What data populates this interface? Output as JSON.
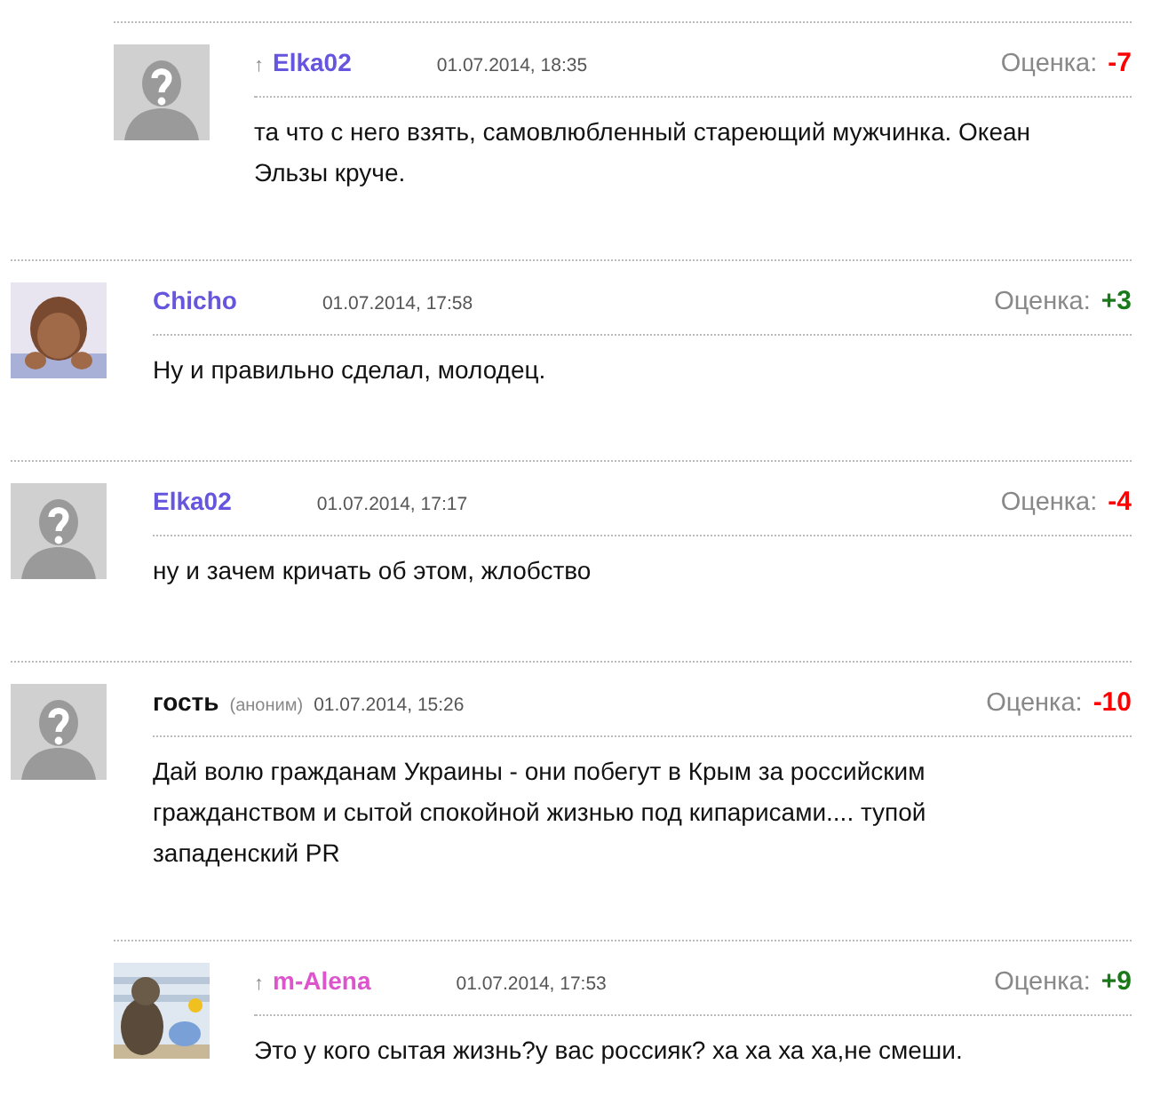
{
  "comments": [
    {
      "reply": true,
      "avatar": {
        "kind": "default"
      },
      "reply_mark": "↑",
      "author": {
        "name": "Elka02",
        "color": "#6655dd"
      },
      "date": "01.07.2014, 18:35",
      "score_label": "Оценка:",
      "score": {
        "value": "-7",
        "color": "#ff0000"
      },
      "text": "та что с него взять, самовлюбленный стареющий мужчинка. Океан Эльзы круче."
    },
    {
      "reply": false,
      "author": {
        "name": "Chicho",
        "color": "#6655dd"
      },
      "date": "01.07.2014, 17:58",
      "score_label": "Оценка:",
      "score": {
        "value": "+3",
        "color": "#1a7a1a"
      },
      "text": "Ну и правильно сделал, молодец."
    },
    {
      "reply": false,
      "avatar": {
        "kind": "default"
      },
      "author": {
        "name": "Elka02",
        "color": "#6655dd"
      },
      "date": "01.07.2014, 17:17",
      "score_label": "Оценка:",
      "score": {
        "value": "-4",
        "color": "#ff0000"
      },
      "text": "ну и зачем кричать об этом, жлобство"
    },
    {
      "reply": false,
      "avatar": {
        "kind": "default"
      },
      "author": {
        "name": "гость",
        "color": "#111111"
      },
      "anon_label": "(аноним)",
      "date": "01.07.2014, 15:26",
      "score_label": "Оценка:",
      "score": {
        "value": "-10",
        "color": "#ff0000"
      },
      "text": "Дай волю гражданам Украины - они побегут в Крым за российским гражданством и сытой спокойной жизнью под кипарисами.... тупой западенский PR"
    },
    {
      "reply": true,
      "reply_mark": "↑",
      "author": {
        "name": "m-Alena",
        "color": "#dd55cc"
      },
      "date": "01.07.2014, 17:53",
      "score_label": "Оценка:",
      "score": {
        "value": "+9",
        "color": "#1a7a1a"
      },
      "text": "Это у кого сытая жизнь?у вас россияк? ха ха ха ха,не смеши."
    }
  ]
}
